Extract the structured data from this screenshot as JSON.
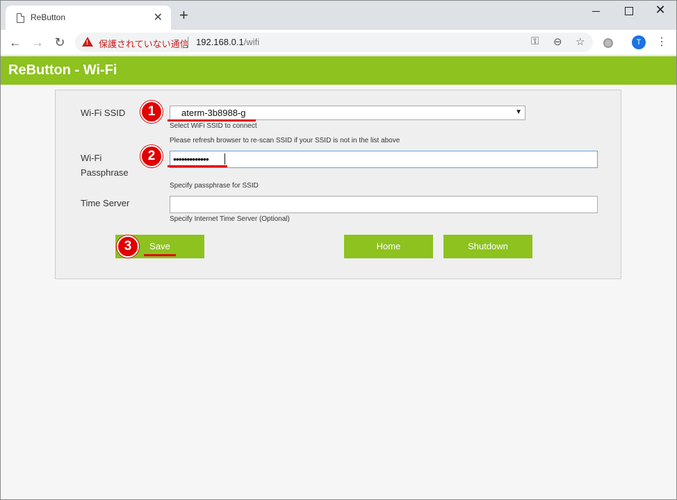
{
  "browser": {
    "tab_title": "ReButton",
    "tab_close": "✕",
    "new_tab": "+",
    "security_text": "保護されていない通信",
    "url_host": "192.168.0.1",
    "url_path": "/wifi",
    "avatar_initial": "T",
    "icons": [
      "page-icon",
      "back-icon",
      "forward-icon",
      "reload-icon",
      "warning-icon",
      "key-icon",
      "zoom-icon",
      "star-icon",
      "extension-icon",
      "menu-icon"
    ]
  },
  "app": {
    "title": "ReButton - Wi-Fi",
    "accent_color": "#8dc21f"
  },
  "form": {
    "ssid": {
      "label": "Wi-Fi SSID",
      "value": "aterm-3b8988-g",
      "hint1": "Select WiFi SSID to connect",
      "hint2": "Please refresh browser to re-scan SSID if your SSID is not in the list above"
    },
    "passphrase": {
      "label_line1": "Wi-Fi",
      "label_line2": "Passphrase",
      "value_masked": "•••••••••••••",
      "hint": "Specify passphrase for SSID"
    },
    "time_server": {
      "label": "Time Server",
      "value": "",
      "hint": "Specify Internet Time Server (Optional)"
    }
  },
  "buttons": {
    "save": "Save",
    "home": "Home",
    "shutdown": "Shutdown"
  },
  "annotations": {
    "marker_1": "1",
    "marker_2": "2",
    "marker_3": "3",
    "marker_color": "#e00000"
  }
}
